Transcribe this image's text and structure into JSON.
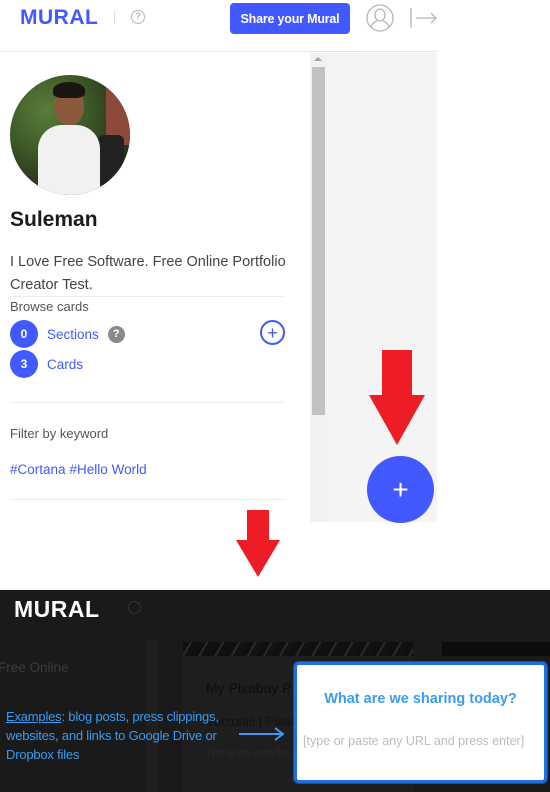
{
  "header": {
    "logo": "MURAL",
    "help_icon": "question-circle-icon",
    "share_button": "Share your Mural",
    "user_icon": "user-avatar-icon",
    "logout_icon": "logout-arrow-icon"
  },
  "profile": {
    "name": "Suleman",
    "bio": "I Love Free Software. Free Online Portfolio Creator Test."
  },
  "browse": {
    "label": "Browse cards",
    "items": [
      {
        "count": "0",
        "label": "Sections",
        "has_help": true
      },
      {
        "count": "3",
        "label": "Cards",
        "has_help": false
      }
    ],
    "help_badge": "?",
    "add_icon": "+"
  },
  "filter": {
    "label": "Filter by keyword",
    "tags": [
      "#Cortana",
      "#Hello World"
    ]
  },
  "fab": {
    "icon": "+"
  },
  "annotations": {
    "arrow_color": "#ee1c25",
    "accent_color": "#4259ff"
  },
  "dark_view": {
    "logo": "MURAL",
    "side_text": "Free Online",
    "card_title": "My Pixabay P",
    "card_subtitle": "Vectonic | Pixaba",
    "card_desc": "This is my contribu... website, Pixabay !!!",
    "examples_link": "Examples",
    "examples_text": ": blog posts, press clippings, websites, and links to Google Drive or Dropbox files",
    "dialog": {
      "title": "What are we sharing today?",
      "placeholder": "[type or paste any URL and press enter]"
    }
  }
}
